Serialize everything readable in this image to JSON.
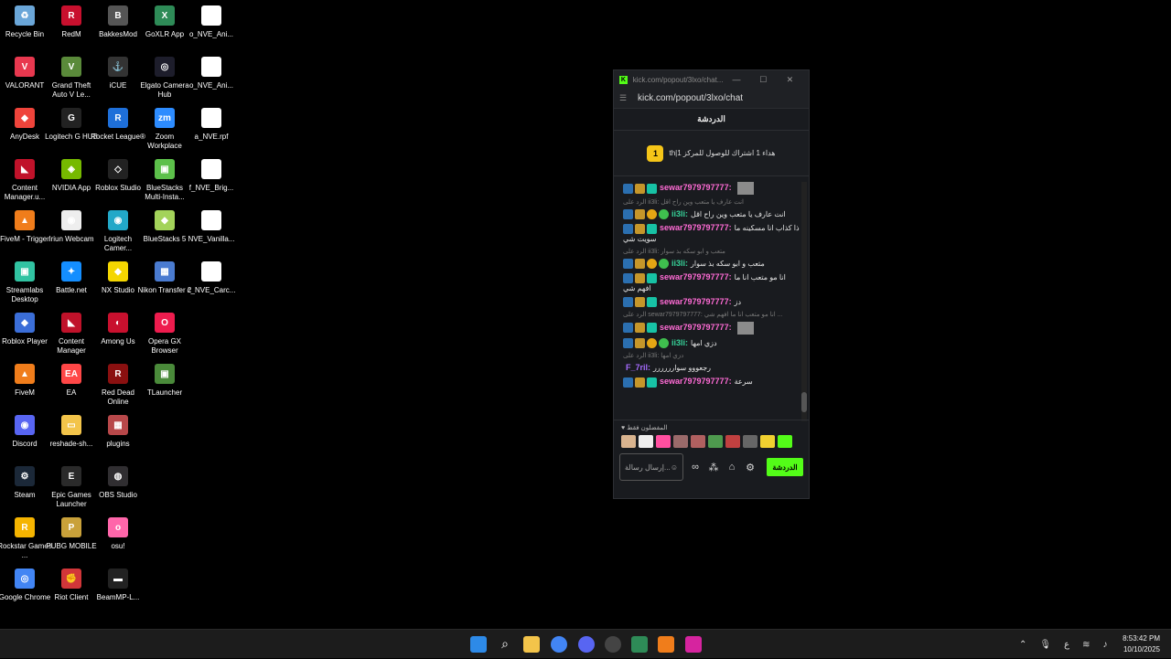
{
  "desktop": {
    "icons": [
      {
        "label": "Recycle Bin",
        "color": "#6aa6d8",
        "glyph": "♻"
      },
      {
        "label": "VALORANT",
        "color": "#e8384f",
        "glyph": "V"
      },
      {
        "label": "AnyDesk",
        "color": "#ef443b",
        "glyph": "◆"
      },
      {
        "label": "Content Manager.u...",
        "color": "#c0122a",
        "glyph": "◣"
      },
      {
        "label": "FiveM - Trigger",
        "color": "#f07d1b",
        "glyph": "▲"
      },
      {
        "label": "Streamlabs Desktop",
        "color": "#31c3a2",
        "glyph": "▣"
      },
      {
        "label": "Roblox Player",
        "color": "#3b6ed8",
        "glyph": "◆"
      },
      {
        "label": "FiveM",
        "color": "#f07d1b",
        "glyph": "▲"
      },
      {
        "label": "Discord",
        "color": "#5865f2",
        "glyph": "◉"
      },
      {
        "label": "Steam",
        "color": "#1b2838",
        "glyph": "⚙"
      },
      {
        "label": "Rockstar Games ...",
        "color": "#f5b400",
        "glyph": "R"
      },
      {
        "label": "Google Chrome",
        "color": "#4285f4",
        "glyph": "◎"
      },
      {
        "label": "RedM",
        "color": "#c8102e",
        "glyph": "R"
      },
      {
        "label": "Grand Theft Auto V Le...",
        "color": "#5a8a3a",
        "glyph": "V"
      },
      {
        "label": "Logitech G HUB",
        "color": "#222222",
        "glyph": "G"
      },
      {
        "label": "NVIDIA App",
        "color": "#76b900",
        "glyph": "◈"
      },
      {
        "label": "Iriun Webcam",
        "color": "#eeeeee",
        "glyph": "◉"
      },
      {
        "label": "Battle.net",
        "color": "#148eff",
        "glyph": "✦"
      },
      {
        "label": "Content Manager",
        "color": "#c0122a",
        "glyph": "◣"
      },
      {
        "label": "EA",
        "color": "#ff4747",
        "glyph": "EA"
      },
      {
        "label": "reshade-sh...",
        "color": "#f3c44a",
        "glyph": "▭"
      },
      {
        "label": "Epic Games Launcher",
        "color": "#2a2a2a",
        "glyph": "E"
      },
      {
        "label": "PUBG MOBILE",
        "color": "#c9a13a",
        "glyph": "P"
      },
      {
        "label": "Riot Client",
        "color": "#d13639",
        "glyph": "✊"
      },
      {
        "label": "BakkesMod",
        "color": "#555555",
        "glyph": "B"
      },
      {
        "label": "iCUE",
        "color": "#333333",
        "glyph": "⚓"
      },
      {
        "label": "Rocket League®",
        "color": "#1e6fd9",
        "glyph": "R"
      },
      {
        "label": "Roblox Studio",
        "color": "#222222",
        "glyph": "◇"
      },
      {
        "label": "Logitech Camer...",
        "color": "#22a8c8",
        "glyph": "◉"
      },
      {
        "label": "NX Studio",
        "color": "#f4d600",
        "glyph": "◆"
      },
      {
        "label": "Among Us",
        "color": "#c8102e",
        "glyph": "◐"
      },
      {
        "label": "Red Dead Online",
        "color": "#8a1010",
        "glyph": "R"
      },
      {
        "label": "plugins",
        "color": "#b8484a",
        "glyph": "▦"
      },
      {
        "label": "OBS Studio",
        "color": "#302e31",
        "glyph": "◍"
      },
      {
        "label": "osu!",
        "color": "#ff66aa",
        "glyph": "o"
      },
      {
        "label": "BeamMP-L...",
        "color": "#222222",
        "glyph": "▬"
      },
      {
        "label": "GoXLR App",
        "color": "#2e8b57",
        "glyph": "X"
      },
      {
        "label": "Elgato Camera Hub",
        "color": "#1d1d2b",
        "glyph": "◎"
      },
      {
        "label": "Zoom Workplace",
        "color": "#2d8cff",
        "glyph": "zm"
      },
      {
        "label": "BlueStacks Multi-Insta...",
        "color": "#5cc04a",
        "glyph": "▣"
      },
      {
        "label": "BlueStacks 5",
        "color": "#a3d35a",
        "glyph": "◆"
      },
      {
        "label": "Nikon Transfer 2",
        "color": "#4a7bd0",
        "glyph": "▦"
      },
      {
        "label": "Opera GX Browser",
        "color": "#ee1c4e",
        "glyph": "O"
      },
      {
        "label": "TLauncher",
        "color": "#4a8a3a",
        "glyph": "▣"
      },
      {
        "label": "o_NVE_Ani...",
        "color": "#ffffff",
        "glyph": ""
      },
      {
        "label": "o_NVE_Ani...",
        "color": "#ffffff",
        "glyph": ""
      },
      {
        "label": "a_NVE.rpf",
        "color": "#ffffff",
        "glyph": ""
      },
      {
        "label": "f_NVE_Brig...",
        "color": "#ffffff",
        "glyph": ""
      },
      {
        "label": "NVE_Vanilla...",
        "color": "#ffffff",
        "glyph": ""
      },
      {
        "label": "c_NVE_Carc...",
        "color": "#ffffff",
        "glyph": ""
      }
    ]
  },
  "chat": {
    "window_title": "kick.com/popout/3lxo/chat...",
    "url": "kick.com/popout/3lxo/chat",
    "header": "الدردشة",
    "pinned_badge": "1",
    "pinned_text": "th|هداء 1 اشتراك للوصول للمركز 1",
    "messages": [
      {
        "user": "sewar7979797777:",
        "color": "u-pink",
        "text": "",
        "badges": [
          "pick",
          "crown",
          "sub"
        ],
        "reply": "",
        "emote": true
      },
      {
        "user": "ii3li:",
        "color": "u-green",
        "text": "انت عارف يا متعب وين راح اقل",
        "badges": [
          "pick",
          "crown",
          "one",
          "ver"
        ],
        "reply": "الرد على ii3li: انت عارف يا متعب وين راح اقل",
        "emote": false
      },
      {
        "user": "sewar7979797777:",
        "color": "u-pink",
        "text": "ذا كذاب انا مسكينه ما سويت شي",
        "badges": [
          "pick",
          "crown",
          "sub"
        ],
        "reply": "",
        "emote": false
      },
      {
        "user": "ii3li:",
        "color": "u-green",
        "text": "متعب و ابو سكه بذ سوار",
        "badges": [
          "pick",
          "crown",
          "one",
          "ver"
        ],
        "reply": "الرد على ii3li: متعب و ابو سكه بذ سوار",
        "emote": false
      },
      {
        "user": "sewar7979797777:",
        "color": "u-pink",
        "text": "انا مو متعب انا ما افهم شي",
        "badges": [
          "pick",
          "crown",
          "sub"
        ],
        "reply": "",
        "emote": false
      },
      {
        "user": "sewar7979797777:",
        "color": "u-pink",
        "text": "دز",
        "badges": [
          "pick",
          "crown",
          "sub"
        ],
        "reply": "",
        "emote": false
      },
      {
        "user": "sewar7979797777:",
        "color": "u-pink",
        "text": "",
        "badges": [
          "pick",
          "crown",
          "sub"
        ],
        "reply": "الرد على sewar7979797777: انا مو متعب انا ما افهم شي ...",
        "emote": true
      },
      {
        "user": "ii3li:",
        "color": "u-green",
        "text": "دزي امها",
        "badges": [
          "pick",
          "crown",
          "one",
          "ver"
        ],
        "reply": "",
        "emote": false
      },
      {
        "user": "F_7ril:",
        "color": "u-purple",
        "text": "رجعووو سوارررررر",
        "badges": [],
        "reply": "الرد على ii3li: دزي امها",
        "emote": false
      },
      {
        "user": "sewar7979797777:",
        "color": "u-pink",
        "text": "سرعة",
        "badges": [
          "pick",
          "crown",
          "sub"
        ],
        "reply": "",
        "emote": false
      }
    ],
    "favorites_label": "المفضلون فقط",
    "input_placeholder": "إرسال رسالة...",
    "send_label": "الدردشة"
  },
  "taskbar": {
    "time": "8:53:42 PM",
    "date": "10/10/2025",
    "lang": "ع"
  }
}
